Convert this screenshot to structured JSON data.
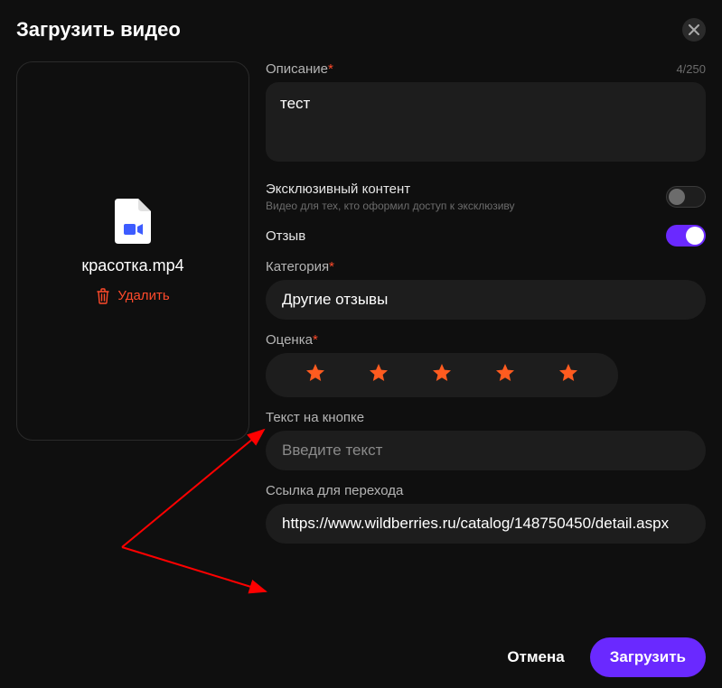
{
  "header": {
    "title": "Загрузить видео"
  },
  "file": {
    "name": "красотка.mp4",
    "delete_label": "Удалить"
  },
  "description": {
    "label": "Описание",
    "value": "тест",
    "counter": "4/250"
  },
  "exclusive": {
    "title": "Эксклюзивный контент",
    "subtitle": "Видео для тех, кто оформил доступ к эксклюзиву",
    "enabled": false
  },
  "review": {
    "title": "Отзыв",
    "enabled": true
  },
  "category": {
    "label": "Категория",
    "value": "Другие отзывы"
  },
  "rating": {
    "label": "Оценка",
    "value": 5
  },
  "button_text": {
    "label": "Текст на кнопке",
    "placeholder": "Введите текст",
    "value": ""
  },
  "link": {
    "label": "Ссылка для перехода",
    "value": "https://www.wildberries.ru/catalog/148750450/detail.aspx"
  },
  "footer": {
    "cancel": "Отмена",
    "submit": "Загрузить"
  }
}
